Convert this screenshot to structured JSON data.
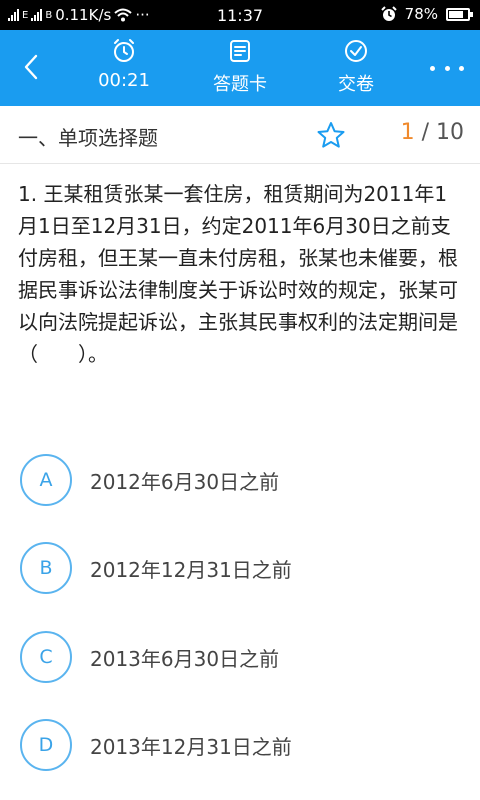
{
  "status_bar": {
    "speed": "0.11K/s",
    "dots": "···",
    "time": "11:37",
    "battery": "78%",
    "battery_level": 0.78,
    "sim_tag": "E",
    "sim2_tag": "B"
  },
  "header": {
    "timer": "00:21",
    "answer_card": "答题卡",
    "submit": "交卷"
  },
  "section": {
    "title": "一、单项选择题",
    "current_page": "1",
    "separator": "/",
    "total_pages": "10"
  },
  "question": {
    "text": "1. 王某租赁张某一套住房，租赁期间为2011年1月1日至12月31日，约定2011年6月30日之前支付房租，但王某一直未付房租，张某也未催要，根据民事诉讼法律制度关于诉讼时效的规定，张某可以向法院提起诉讼，主张其民事权利的法定期间是（　　）。"
  },
  "options": [
    {
      "letter": "A",
      "text": "2012年6月30日之前"
    },
    {
      "letter": "B",
      "text": "2012年12月31日之前"
    },
    {
      "letter": "C",
      "text": "2013年6月30日之前"
    },
    {
      "letter": "D",
      "text": "2013年12月31日之前"
    }
  ],
  "colors": {
    "header_bg": "#1a9cf0",
    "accent_orange": "#f08a2c",
    "option_border": "#5ab4ef"
  },
  "icons": [
    "back-arrow-icon",
    "alarm-clock-icon",
    "answer-card-icon",
    "check-circle-icon",
    "more-icon",
    "star-icon",
    "wifi-icon",
    "alarm-icon",
    "battery-icon"
  ]
}
